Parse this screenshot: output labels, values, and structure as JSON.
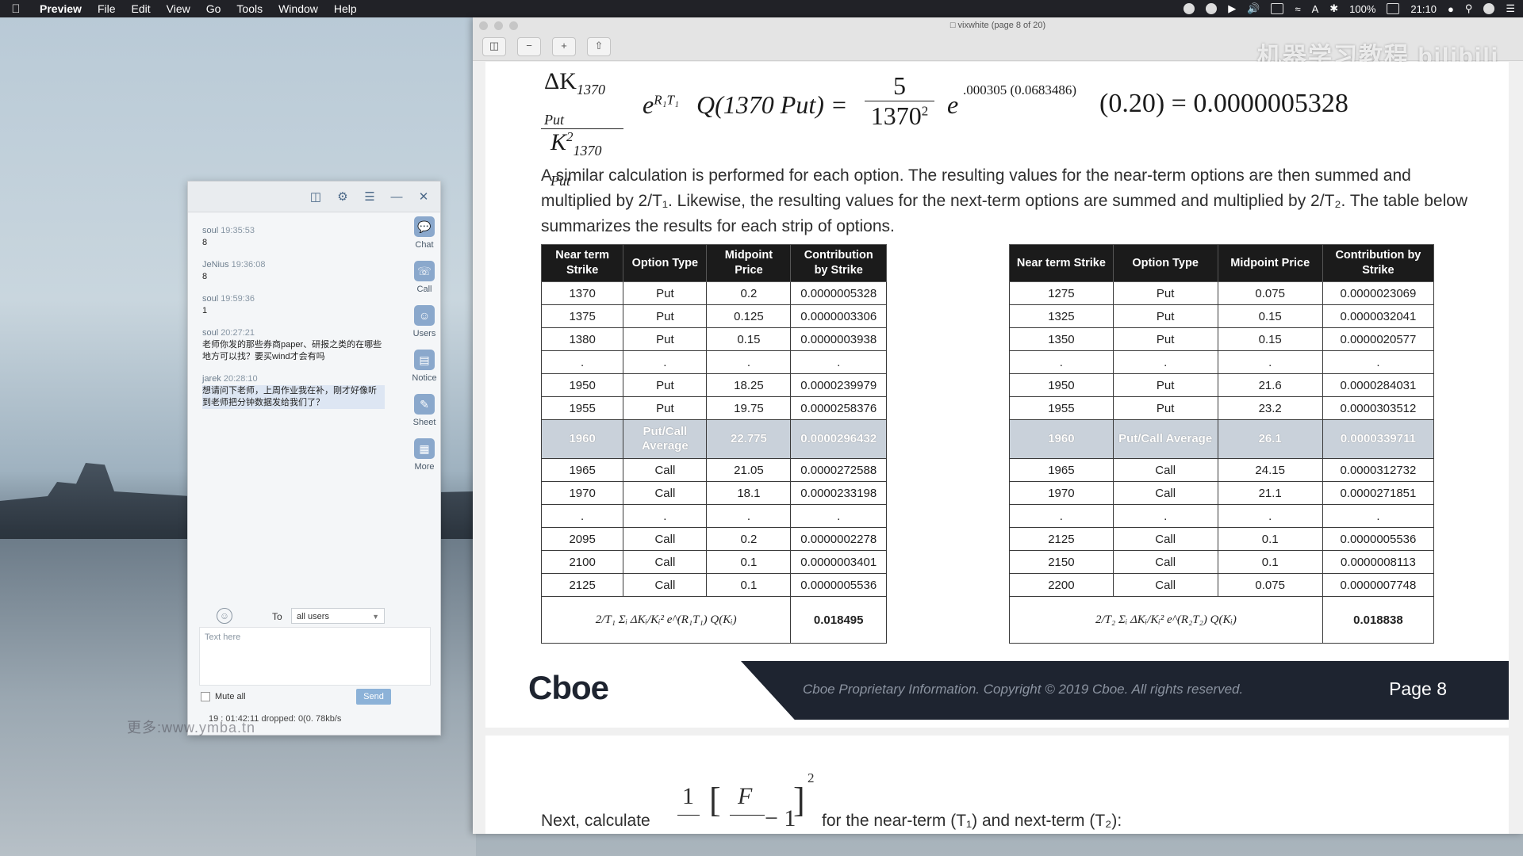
{
  "menubar": {
    "app": "Preview",
    "menus": [
      "File",
      "Edit",
      "View",
      "Go",
      "Tools",
      "Window",
      "Help"
    ],
    "battery": "100%",
    "time": "21:10"
  },
  "chat": {
    "messages": [
      {
        "name": "soul",
        "time": "19:35:53",
        "text": "8"
      },
      {
        "name": "JeNius",
        "time": "19:36:08",
        "text": "8"
      },
      {
        "name": "soul",
        "time": "19:59:36",
        "text": "1"
      },
      {
        "name": "soul",
        "time": "20:27:21",
        "text": "老师你发的那些券商paper、研报之类的在哪些地方可以找？要买wind才会有吗"
      },
      {
        "name": "jarek",
        "time": "20:28:10",
        "text": "想请问下老师，上周作业我在补，刚才好像听到老师把分钟数据发给我们了？"
      }
    ],
    "side": [
      "Chat",
      "Call",
      "Users",
      "Notice",
      "Sheet",
      "More"
    ],
    "to_label": "To",
    "to_value": "all users",
    "placeholder": "Text here",
    "mute_label": "Mute all",
    "send_label": "Send",
    "status": "19 : 01:42:11   dropped: 0(0.   78kb/s"
  },
  "desktop_watermark": "更多:www.ymba.tn",
  "preview": {
    "title": "vixwhite (page 8 of 20)",
    "watermark": "机器学习教程 bilibili"
  },
  "equation": {
    "left_num": "ΔK",
    "left_num_sub": "1370 Put",
    "left_den": "K",
    "left_den_sup": "2",
    "left_den_sub": "1370 Put",
    "exp": "e",
    "exp_sup": "R₁T₁",
    "q": "Q(1370 Put) =",
    "five": "5",
    "den": "1370",
    "den_sup": "2",
    "e2": "e",
    "e2_sup": ".000305 (0.0683486)",
    "tail": "(0.20) = 0.0000005328"
  },
  "paragraph": "A similar calculation is performed for each option.  The resulting values for the near-term options are then summed and multiplied by 2/T₁.  Likewise, the resulting values for the next-term options are summed and multiplied by 2/T₂.  The table below summarizes the results for each strip of options.",
  "table_headers": [
    "Near term Strike",
    "Option Type",
    "Midpoint Price",
    "Contribution by Strike"
  ],
  "near_table": {
    "rows": [
      [
        "1370",
        "Put",
        "0.2",
        "0.0000005328"
      ],
      [
        "1375",
        "Put",
        "0.125",
        "0.0000003306"
      ],
      [
        "1380",
        "Put",
        "0.15",
        "0.0000003938"
      ],
      [
        ".",
        ".",
        ".",
        "."
      ],
      [
        "1950",
        "Put",
        "18.25",
        "0.0000239979"
      ],
      [
        "1955",
        "Put",
        "19.75",
        "0.0000258376"
      ],
      [
        "1960",
        "Put/Call Average",
        "22.775",
        "0.0000296432"
      ],
      [
        "1965",
        "Call",
        "21.05",
        "0.0000272588"
      ],
      [
        "1970",
        "Call",
        "18.1",
        "0.0000233198"
      ],
      [
        ".",
        ".",
        ".",
        "."
      ],
      [
        "2095",
        "Call",
        "0.2",
        "0.0000002278"
      ],
      [
        "2100",
        "Call",
        "0.1",
        "0.0000003401"
      ],
      [
        "2125",
        "Call",
        "0.1",
        "0.0000005536"
      ]
    ],
    "sum_formula": "2/T₁ Σᵢ ΔKᵢ/Kᵢ² e^(R₁T₁) Q(Kᵢ)",
    "sum_value": "0.018495"
  },
  "next_table": {
    "rows": [
      [
        "1275",
        "Put",
        "0.075",
        "0.0000023069"
      ],
      [
        "1325",
        "Put",
        "0.15",
        "0.0000032041"
      ],
      [
        "1350",
        "Put",
        "0.15",
        "0.0000020577"
      ],
      [
        ".",
        ".",
        ".",
        "."
      ],
      [
        "1950",
        "Put",
        "21.6",
        "0.0000284031"
      ],
      [
        "1955",
        "Put",
        "23.2",
        "0.0000303512"
      ],
      [
        "1960",
        "Put/Call Average",
        "26.1",
        "0.0000339711"
      ],
      [
        "1965",
        "Call",
        "24.15",
        "0.0000312732"
      ],
      [
        "1970",
        "Call",
        "21.1",
        "0.0000271851"
      ],
      [
        ".",
        ".",
        ".",
        "."
      ],
      [
        "2125",
        "Call",
        "0.1",
        "0.0000005536"
      ],
      [
        "2150",
        "Call",
        "0.1",
        "0.0000008113"
      ],
      [
        "2200",
        "Call",
        "0.075",
        "0.0000007748"
      ]
    ],
    "sum_formula": "2/T₂ Σᵢ ΔKᵢ/Kᵢ² e^(R₂T₂) Q(Kᵢ)",
    "sum_value": "0.018838"
  },
  "footer": {
    "logo": "Cboe",
    "copyright": "Cboe Proprietary Information. Copyright © 2019 Cboe.  All rights reserved.",
    "page": "Page 8"
  },
  "next_step": {
    "prefix": "Next, calculate",
    "one": "1",
    "F": "F",
    "minus1": "− 1",
    "sup2": "2",
    "suffix": "for the near-term (T₁) and next-term (T₂):"
  }
}
